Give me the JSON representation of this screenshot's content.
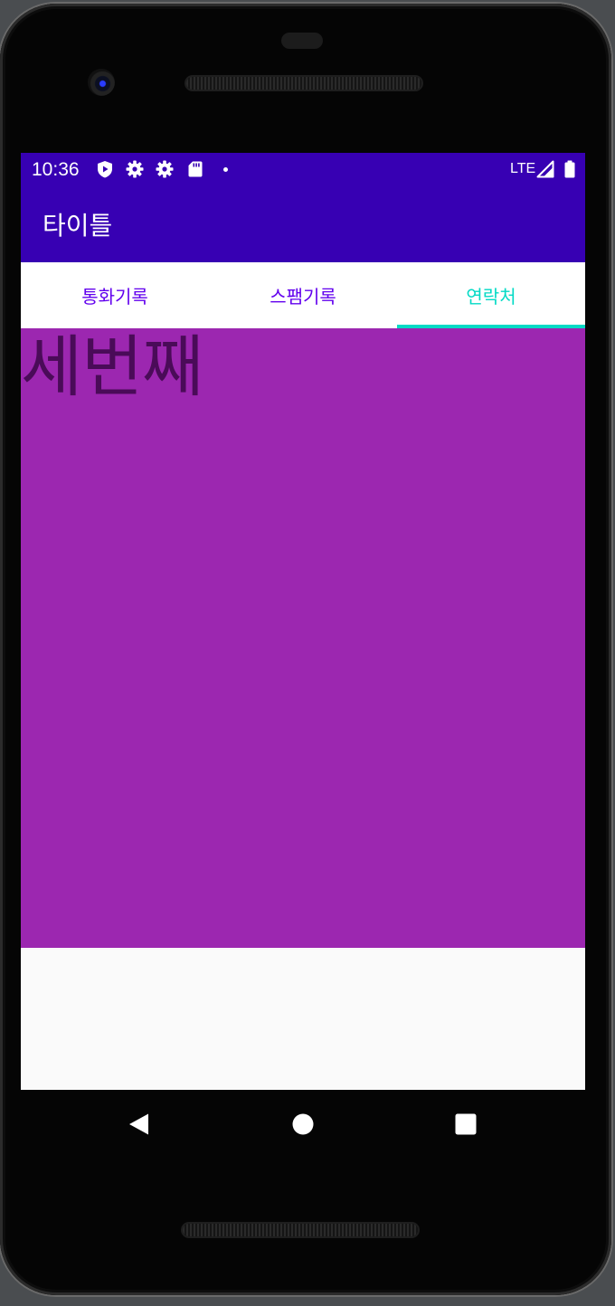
{
  "status_bar": {
    "time": "10:36",
    "icons": [
      "play-protect-icon",
      "settings-gear-icon",
      "settings-gear-icon",
      "sd-card-icon",
      "notification-dot-icon"
    ],
    "network": "LTE",
    "right_icons": [
      "signal-icon",
      "battery-icon"
    ]
  },
  "app_bar": {
    "title": "타이틀"
  },
  "tabs": [
    {
      "label": "통화기록",
      "selected": false
    },
    {
      "label": "스팸기록",
      "selected": false
    },
    {
      "label": "연락처",
      "selected": true
    }
  ],
  "page": {
    "text": "세번째"
  },
  "nav_bar": {
    "buttons": [
      "back-icon",
      "home-icon",
      "recents-icon"
    ]
  },
  "colors": {
    "status_bar": "#3700b3",
    "app_bar": "#3700b3",
    "tab_text": "#6200ee",
    "tab_selected": "#03dac5",
    "content_background": "#9c27b0",
    "content_text": "#4a0b58",
    "screen_background": "#fafafa"
  }
}
